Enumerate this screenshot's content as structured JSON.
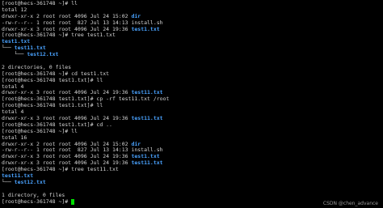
{
  "terminal": {
    "colors": {
      "background": "#000000",
      "text": "#d6d6d6",
      "highlight": "#4aa3ff",
      "cursor": "#00e000"
    },
    "lines": [
      [
        {
          "t": "[root@hecs-361748 ~]# ll",
          "c": "default"
        }
      ],
      [
        {
          "t": "total 12",
          "c": "default"
        }
      ],
      [
        {
          "t": "drwxr-xr-x 2 root root 4096 Jul 24 15:02 ",
          "c": "default"
        },
        {
          "t": "dir",
          "c": "blue"
        }
      ],
      [
        {
          "t": "-rw-r--r-- 1 root root  827 Jul 13 14:13 install.sh",
          "c": "default"
        }
      ],
      [
        {
          "t": "drwxr-xr-x 3 root root 4096 Jul 24 19:36 ",
          "c": "default"
        },
        {
          "t": "test1.txt",
          "c": "blue"
        }
      ],
      [
        {
          "t": "[root@hecs-361748 ~]# tree test1.txt",
          "c": "default"
        }
      ],
      [
        {
          "t": "test1.txt",
          "c": "blue"
        }
      ],
      [
        {
          "t": "└── ",
          "c": "default"
        },
        {
          "t": "test11.txt",
          "c": "blue"
        }
      ],
      [
        {
          "t": "    └── ",
          "c": "default"
        },
        {
          "t": "test12.txt",
          "c": "blue"
        }
      ],
      [
        {
          "t": "",
          "c": "default"
        }
      ],
      [
        {
          "t": "2 directories, 0 files",
          "c": "default"
        }
      ],
      [
        {
          "t": "[root@hecs-361748 ~]# cd test1.txt",
          "c": "default"
        }
      ],
      [
        {
          "t": "[root@hecs-361748 test1.txt]# ll",
          "c": "default"
        }
      ],
      [
        {
          "t": "total 4",
          "c": "default"
        }
      ],
      [
        {
          "t": "drwxr-xr-x 3 root root 4096 Jul 24 19:36 ",
          "c": "default"
        },
        {
          "t": "test11.txt",
          "c": "blue"
        }
      ],
      [
        {
          "t": "[root@hecs-361748 test1.txt]# cp -rf test11.txt /root",
          "c": "default"
        }
      ],
      [
        {
          "t": "[root@hecs-361748 test1.txt]# ll",
          "c": "default"
        }
      ],
      [
        {
          "t": "total 4",
          "c": "default"
        }
      ],
      [
        {
          "t": "drwxr-xr-x 3 root root 4096 Jul 24 19:36 ",
          "c": "default"
        },
        {
          "t": "test11.txt",
          "c": "blue"
        }
      ],
      [
        {
          "t": "[root@hecs-361748 test1.txt]# cd ..",
          "c": "default"
        }
      ],
      [
        {
          "t": "[root@hecs-361748 ~]# ll",
          "c": "default"
        }
      ],
      [
        {
          "t": "total 16",
          "c": "default"
        }
      ],
      [
        {
          "t": "drwxr-xr-x 2 root root 4096 Jul 24 15:02 ",
          "c": "default"
        },
        {
          "t": "dir",
          "c": "blue"
        }
      ],
      [
        {
          "t": "-rw-r--r-- 1 root root  827 Jul 13 14:13 install.sh",
          "c": "default"
        }
      ],
      [
        {
          "t": "drwxr-xr-x 3 root root 4096 Jul 24 19:36 ",
          "c": "default"
        },
        {
          "t": "test1.txt",
          "c": "blue"
        }
      ],
      [
        {
          "t": "drwxr-xr-x 3 root root 4096 Jul 24 19:36 ",
          "c": "default"
        },
        {
          "t": "test11.txt",
          "c": "blue"
        }
      ],
      [
        {
          "t": "[root@hecs-361748 ~]# tree test11.txt",
          "c": "default"
        }
      ],
      [
        {
          "t": "test11.txt",
          "c": "blue"
        }
      ],
      [
        {
          "t": "└── ",
          "c": "default"
        },
        {
          "t": "test12.txt",
          "c": "blue"
        }
      ],
      [
        {
          "t": "",
          "c": "default"
        }
      ],
      [
        {
          "t": "1 directory, 0 files",
          "c": "default"
        }
      ],
      [
        {
          "t": "[root@hecs-361748 ~]# ",
          "c": "default"
        }
      ]
    ],
    "cursor_on_last_line": true
  },
  "watermark": {
    "text": "CSDN @chen_advance"
  }
}
